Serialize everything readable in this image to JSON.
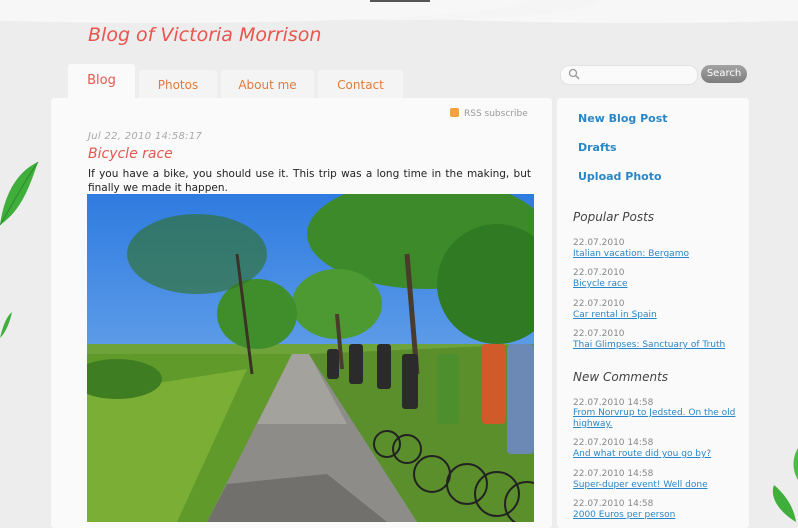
{
  "header": {
    "site_title": "Blog of Victoria Morrison"
  },
  "tabs": [
    {
      "label": "Blog",
      "active": true
    },
    {
      "label": "Photos",
      "active": false
    },
    {
      "label": "About me",
      "active": false
    },
    {
      "label": "Contact",
      "active": false
    }
  ],
  "search": {
    "placeholder": "",
    "button_label": "Search"
  },
  "main": {
    "rss_label": "RSS subscribe",
    "post": {
      "date": "Jul 22, 2010 14:58:17",
      "title": "Bicycle race",
      "text": "If you have a bike, you should use it. This trip was a long time in the making, but finally we made it happen."
    }
  },
  "sidebar": {
    "actions": [
      "New Blog Post",
      "Drafts",
      "Upload Photo"
    ],
    "popular_heading": "Popular Posts",
    "popular": [
      {
        "date": "22.07.2010",
        "title": "Italian vacation: Bergamo"
      },
      {
        "date": "22.07.2010",
        "title": "Bicycle race"
      },
      {
        "date": "22.07.2010",
        "title": "Car rental in Spain"
      },
      {
        "date": "22.07.2010",
        "title": "Thai Glimpses: Sanctuary of Truth"
      }
    ],
    "comments_heading": "New Comments",
    "comments": [
      {
        "date": "22.07.2010 14:58",
        "text": "From Norvrup to Jedsted. On the old highway."
      },
      {
        "date": "22.07.2010 14:58",
        "text": "And what route did you go by?"
      },
      {
        "date": "22.07.2010 14:58",
        "text": "Super-duper event! Well done"
      },
      {
        "date": "22.07.2010 14:58",
        "text": "2000 Euros per person"
      }
    ]
  },
  "colors": {
    "accent": "#e8554e",
    "tab_text": "#e07b3c",
    "link": "#2a87c7"
  }
}
